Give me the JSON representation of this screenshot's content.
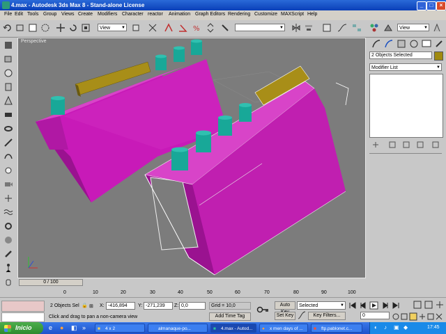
{
  "window": {
    "title": "4.max - Autodesk 3ds Max 8   - Stand-alone License",
    "min_label": "_",
    "max_label": "□",
    "close_label": "×"
  },
  "menu": [
    "File",
    "Edit",
    "Tools",
    "Group",
    "Views",
    "Create",
    "Modifiers",
    "Character",
    "reactor",
    "Animation",
    "Graph Editors",
    "Rendering",
    "Customize",
    "MAXScript",
    "Help"
  ],
  "toolbar": {
    "ref_coord": "View",
    "named_selection": "",
    "view_right": "View"
  },
  "viewport": {
    "label": "Perspective",
    "bg_color": "#7c7c7c",
    "object_color": "#c020b0",
    "cylinder_color": "#18a898",
    "bar_color": "#a08a10"
  },
  "command_panel": {
    "selection_name": "2 Objects Selected",
    "modifier_list": "Modifier List"
  },
  "timeline": {
    "frame_display": "0 / 100",
    "ticks": [
      "0",
      "10",
      "20",
      "30",
      "40",
      "50",
      "60",
      "70",
      "80",
      "90",
      "100"
    ]
  },
  "status": {
    "selection": "2 Objects Sel",
    "x_label": "X:",
    "x_value": "-416,894",
    "y_label": "Y:",
    "y_value": "-271,239",
    "z_label": "Z:",
    "z_value": "0,0",
    "grid": "Grid = 10,0",
    "prompt": "Click and drag to pan a non-camera view",
    "add_time_tag": "Add Time Tag",
    "auto_key": "Auto Key",
    "set_key": "Set Key",
    "key_mode": "Selected",
    "key_filters": "Key Filters...",
    "frame": "0"
  },
  "taskbar": {
    "start": "Inicio",
    "tasks": [
      "4 x 2",
      "almanaque-po...",
      "4.max - Autod...",
      "x men days of ...",
      "ftp.pablonet.c..."
    ],
    "clock": "17:45"
  }
}
